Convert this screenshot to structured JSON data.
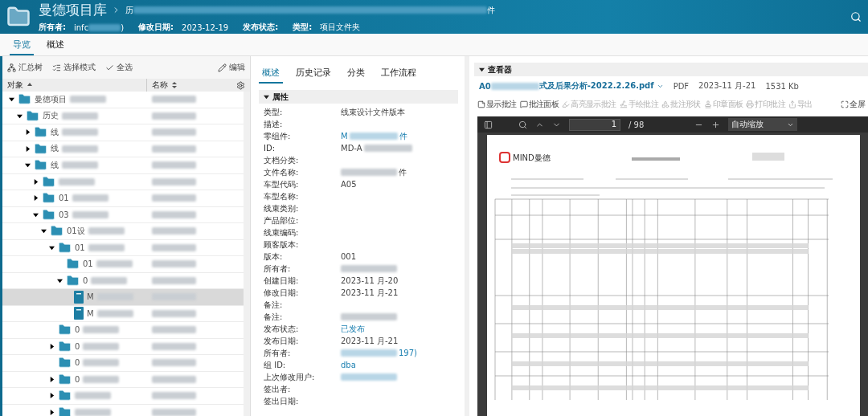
{
  "header": {
    "title": "曼德项目库",
    "breadcrumb": [
      {
        "text": "历",
        "redacted": true,
        "end": "件"
      }
    ],
    "meta": [
      {
        "label": "所有者:",
        "value": "infc",
        "redacted": true,
        "end": ")"
      },
      {
        "label": "修改日期:",
        "value": "2023-12-19"
      },
      {
        "label": "发布状态:"
      },
      {
        "label": "类型:",
        "value": "项目文件夹"
      }
    ]
  },
  "tabs": [
    {
      "label": "导览",
      "selected": true
    },
    {
      "label": "概述",
      "selected": false
    }
  ],
  "left_toolbar": [
    {
      "label": "汇总树",
      "kind": "tree"
    },
    {
      "label": "选择模式",
      "kind": "select"
    },
    {
      "label": "全选",
      "kind": "check"
    }
  ],
  "edit_button": "编辑",
  "columns": [
    {
      "label": "对象",
      "sorted": true
    },
    {
      "label": "名称",
      "sorted": false
    }
  ],
  "tree": [
    {
      "label": "曼德项目",
      "kind": "folder",
      "redacted": true,
      "expanded": true,
      "selected": false,
      "children": [
        {
          "label": "历史",
          "kind": "folder",
          "redacted": true,
          "expanded": true,
          "selected": false,
          "children": [
            {
              "label": "线",
              "kind": "folder",
              "redacted": true,
              "expanded": false,
              "selected": false
            },
            {
              "label": "线",
              "kind": "folder",
              "redacted": true,
              "expanded": false,
              "selected": false
            },
            {
              "label": "线",
              "kind": "folder",
              "redacted": true,
              "expanded": true,
              "selected": false,
              "children": [
                {
                  "kind": "folder",
                  "redacted": true,
                  "expanded": false,
                  "selected": false
                },
                {
                  "label": "01",
                  "kind": "folder",
                  "redacted": true,
                  "expanded": false,
                  "selected": false
                },
                {
                  "label": "03",
                  "kind": "folder",
                  "redacted": true,
                  "expanded": true,
                  "selected": false,
                  "children": [
                    {
                      "label": "01设",
                      "kind": "folder",
                      "redacted": true,
                      "expanded": true,
                      "selected": false,
                      "children": [
                        {
                          "label": "01",
                          "kind": "folder",
                          "redacted": true,
                          "expanded": true,
                          "selected": false,
                          "children": [
                            {
                              "label": "01",
                              "kind": "folder",
                              "redacted": true,
                              "selected": false
                            },
                            {
                              "label": "0",
                              "kind": "folder",
                              "redacted": true,
                              "expanded": true,
                              "selected": false,
                              "children": [
                                {
                                  "label": "M",
                                  "kind": "file",
                                  "redacted": true,
                                  "selected": true
                                },
                                {
                                  "label": "M",
                                  "kind": "file",
                                  "redacted": true,
                                  "selected": false
                                }
                              ]
                            }
                          ]
                        },
                        {
                          "label": "0",
                          "kind": "folder",
                          "redacted": true,
                          "selected": false
                        },
                        {
                          "label": "0",
                          "kind": "folder",
                          "redacted": true,
                          "expanded": false,
                          "selected": false
                        },
                        {
                          "label": "0",
                          "kind": "folder",
                          "redacted": true,
                          "selected": false
                        },
                        {
                          "label": "0",
                          "kind": "folder",
                          "redacted": true,
                          "expanded": false,
                          "selected": false
                        },
                        {
                          "kind": "folder",
                          "redacted": true,
                          "expanded": false,
                          "selected": false
                        },
                        {
                          "kind": "folder",
                          "redacted": true,
                          "expanded": false,
                          "selected": false
                        }
                      ]
                    }
                  ]
                }
              ]
            }
          ]
        }
      ]
    }
  ],
  "detail_tabs": [
    {
      "label": "概述",
      "selected": true
    },
    {
      "label": "历史记录",
      "selected": false
    },
    {
      "label": "分类",
      "selected": false
    },
    {
      "label": "工作流程",
      "selected": false
    }
  ],
  "properties": {
    "title": "属性",
    "rows": [
      {
        "label": "类型:",
        "value": "线束设计文件版本"
      },
      {
        "label": "描述:"
      },
      {
        "label": "零组件:",
        "value": "M",
        "redacted": true,
        "end": "件",
        "link": true
      },
      {
        "label": "ID:",
        "value": "MD-A",
        "redacted": true
      },
      {
        "label": "文档分类:"
      },
      {
        "label": "文件名称:",
        "redacted": true,
        "end": "件"
      },
      {
        "label": "车型代码:",
        "value": "A05"
      },
      {
        "label": "车型名称:"
      },
      {
        "label": "线束类别:"
      },
      {
        "label": "产品部位:"
      },
      {
        "label": "线束编码:"
      },
      {
        "label": "顾客版本:"
      },
      {
        "label": "版本:",
        "value": "001"
      },
      {
        "label": "所有者:",
        "redacted": true
      },
      {
        "label": "创建日期:",
        "value": "2023-11 月-20"
      },
      {
        "label": "修改日期:",
        "value": "2023-11 月-21"
      },
      {
        "label": "备注:"
      },
      {
        "label": "备注:",
        "redacted": true
      },
      {
        "label": "发布状态:",
        "value": "已发布",
        "link": true
      },
      {
        "label": "发布日期:",
        "value": "2023-11 月-21"
      },
      {
        "label": "所有者:",
        "redacted": true,
        "end": "197)",
        "link": true
      },
      {
        "label": "组 ID:",
        "value": "dba",
        "link": true
      },
      {
        "label": "上次修改用户:",
        "redacted": true,
        "link": true
      },
      {
        "label": "签出者:"
      },
      {
        "label": "签出日期:"
      }
    ]
  },
  "viewer": {
    "title": "查看器",
    "file": {
      "name": "A0",
      "redacted": true,
      "end": "式及后果分析-2022.2.26.pdf",
      "type": "PDF",
      "date": "2023-11 月-21",
      "size": "1531 Kb"
    },
    "tools": [
      {
        "label": "显示批注",
        "kind": "note",
        "disabled": false
      },
      {
        "label": "批注面板",
        "kind": "panel",
        "disabled": false
      },
      {
        "label": "高亮显示批注",
        "kind": "pen",
        "disabled": true
      },
      {
        "label": "手绘批注",
        "kind": "draw",
        "disabled": true
      },
      {
        "label": "批注形状",
        "kind": "shape",
        "disabled": true
      },
      {
        "label": "印章面板",
        "kind": "stamp",
        "disabled": true
      },
      {
        "label": "打印批注",
        "kind": "print",
        "disabled": true
      },
      {
        "label": "导出",
        "kind": "export",
        "disabled": true
      }
    ],
    "fullscreen": "全屏",
    "pdf": {
      "page": "1",
      "pages": "/ 98",
      "zoom": "自动缩放",
      "logo": "MIND曼德"
    }
  }
}
